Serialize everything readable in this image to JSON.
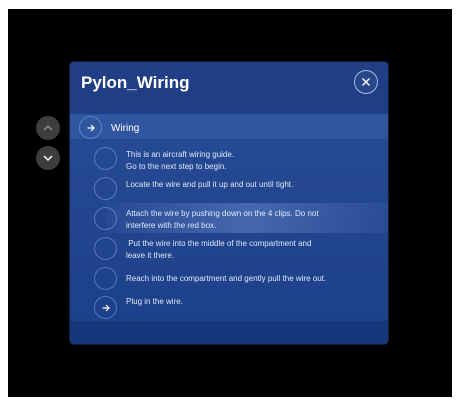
{
  "panel": {
    "title": "Pylon_Wiring",
    "close_icon": "close-icon"
  },
  "nav": {
    "up_icon": "chevron-up-icon",
    "down_icon": "chevron-down-icon"
  },
  "section": {
    "label": "Wiring",
    "icon": "arrow-right-icon"
  },
  "steps": [
    {
      "line1": "This is an aircraft wiring guide.",
      "line2": "Go to the next step to begin.",
      "icon": "circle-icon"
    },
    {
      "line1": "Locate the wire and pull it up and out until tight.",
      "line2": "",
      "icon": "circle-icon"
    },
    {
      "line1": "Attach the wire by pushing down on the 4 clips.  Do not",
      "line2": "interfere with the red box.",
      "icon": "circle-icon"
    },
    {
      "line1": " Put the wire into the middle of the compartment and",
      "line2": "leave it there.",
      "icon": "circle-icon"
    },
    {
      "line1": "Reach into the compartment and gently pull the wire out.",
      "line2": "",
      "icon": "circle-icon"
    },
    {
      "line1": "Plug in the wire.",
      "line2": "",
      "icon": "arrow-right-icon"
    }
  ],
  "colors": {
    "panel_background": "#1c3b83",
    "text": "#dfe8fa"
  }
}
